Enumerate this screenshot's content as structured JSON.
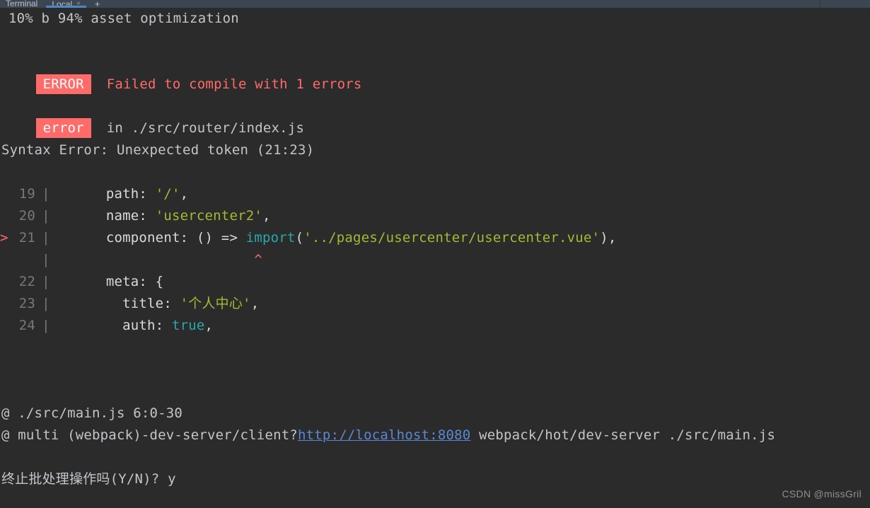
{
  "window": {
    "tool_window_title": "Terminal",
    "tabs": [
      {
        "label": "Local",
        "active": true,
        "close_glyph": "×"
      }
    ],
    "add_tab_glyph": "+"
  },
  "terminal": {
    "progress_line": "10% b 94% asset optimization",
    "error_summary": {
      "badge": "ERROR",
      "message": "Failed to compile with 1 errors"
    },
    "error_detail": {
      "badge": "error",
      "message": "in ./src/router/index.js"
    },
    "syntax_error_line": "Syntax Error: Unexpected token (21:23)",
    "code_frame": [
      {
        "marker": " ",
        "lineno": "19",
        "pipe": "|",
        "indent": "      ",
        "tokens": [
          {
            "text": "path",
            "color": "white"
          },
          {
            "text": ": ",
            "color": "white"
          },
          {
            "text": "'/'",
            "color": "olive"
          },
          {
            "text": ",",
            "color": "white"
          }
        ]
      },
      {
        "marker": " ",
        "lineno": "20",
        "pipe": "|",
        "indent": "      ",
        "tokens": [
          {
            "text": "name",
            "color": "white"
          },
          {
            "text": ": ",
            "color": "white"
          },
          {
            "text": "'usercenter2'",
            "color": "olive"
          },
          {
            "text": ",",
            "color": "white"
          }
        ]
      },
      {
        "marker": ">",
        "lineno": "21",
        "pipe": "|",
        "indent": "      ",
        "tokens": [
          {
            "text": "component",
            "color": "white"
          },
          {
            "text": ": () => ",
            "color": "white"
          },
          {
            "text": "import",
            "color": "cyan"
          },
          {
            "text": "(",
            "color": "white"
          },
          {
            "text": "'../pages/usercenter/usercenter.vue'",
            "color": "olive"
          },
          {
            "text": "),",
            "color": "white"
          }
        ]
      },
      {
        "marker": " ",
        "lineno": "",
        "pipe": "|",
        "indent": "                        ",
        "tokens": [
          {
            "text": "^",
            "color": "salmon"
          }
        ]
      },
      {
        "marker": " ",
        "lineno": "22",
        "pipe": "|",
        "indent": "      ",
        "tokens": [
          {
            "text": "meta",
            "color": "white"
          },
          {
            "text": ": {",
            "color": "white"
          }
        ]
      },
      {
        "marker": " ",
        "lineno": "23",
        "pipe": "|",
        "indent": "        ",
        "tokens": [
          {
            "text": "title",
            "color": "white"
          },
          {
            "text": ": ",
            "color": "white"
          },
          {
            "text": "'个人中心'",
            "color": "olive"
          },
          {
            "text": ",",
            "color": "white"
          }
        ]
      },
      {
        "marker": " ",
        "lineno": "24",
        "pipe": "|",
        "indent": "        ",
        "tokens": [
          {
            "text": "auth",
            "color": "white"
          },
          {
            "text": ": ",
            "color": "white"
          },
          {
            "text": "true",
            "color": "cyan"
          },
          {
            "text": ",",
            "color": "white"
          }
        ]
      }
    ],
    "module_refs": [
      {
        "segments": [
          {
            "text": "@ ./src/main.js 6:0-30",
            "color": "gray"
          }
        ]
      },
      {
        "segments": [
          {
            "text": "@ multi (webpack)-dev-server/client?",
            "color": "gray"
          },
          {
            "text": "http://localhost:8080",
            "color": "link"
          },
          {
            "text": " webpack/hot/dev-server ./src/main.js",
            "color": "gray"
          }
        ]
      }
    ],
    "shell_prompt": "终止批处理操作吗(Y/N)? y"
  },
  "watermark": "CSDN @missGril",
  "colors": {
    "background": "#2b2b2b",
    "header_background": "#3c4552",
    "accent_tab": "#4a88c7",
    "error_badge": "#ff6b68",
    "link": "#5a88d6",
    "string": "#a9b832",
    "keyword": "#2aa8a8"
  }
}
